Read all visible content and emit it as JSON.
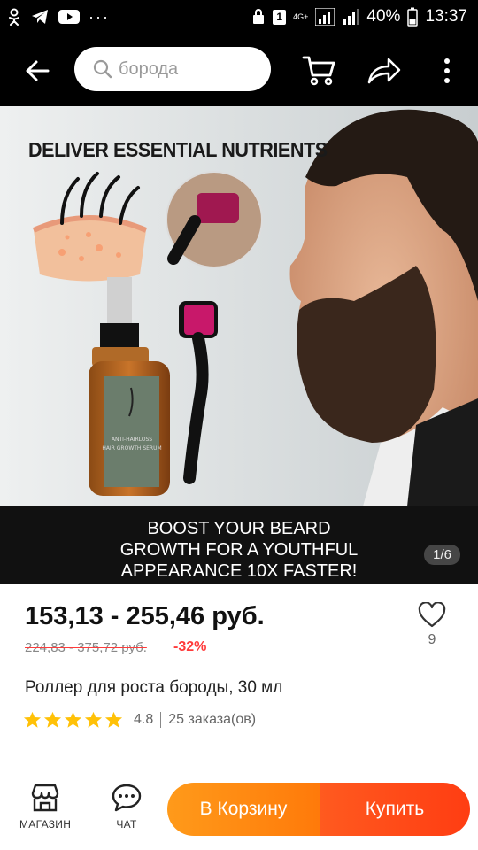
{
  "status_bar": {
    "battery": "40%",
    "time": "13:37",
    "sim_badge": "1",
    "network": "4G+",
    "more": "···"
  },
  "app_bar": {
    "search_placeholder": "борода",
    "icons": [
      "back-arrow-icon",
      "search-icon",
      "cart-icon",
      "share-icon",
      "more-vertical-icon"
    ]
  },
  "product_image": {
    "headline": "DELIVER ESSENTIAL NUTRIENTS",
    "caption_lines": [
      "BOOST YOUR BEARD",
      "GROWTH FOR A YOUTHFUL",
      "APPEARANCE 10X FASTER!"
    ],
    "bottle_label": [
      "ANTI-HAIRLOSS",
      "HAIR GROWTH SERUM"
    ],
    "counter": "1/6"
  },
  "product": {
    "price": "153,13 - 255,46 руб.",
    "old_price": "224,83 - 375,72 руб.",
    "discount": "-32%",
    "favorites_count": "9",
    "title": "Роллер для роста бороды, 30 мл",
    "rating": "4.8",
    "rating_stars": 5,
    "orders": "25 заказа(ов)"
  },
  "bottom_bar": {
    "store_label": "МАГАЗИН",
    "chat_label": "ЧАТ",
    "cart_label": "В Корзину",
    "buy_label": "Купить"
  },
  "colors": {
    "accent_orange": "#ff8a14",
    "accent_red": "#ff4a18",
    "discount_red": "#ff3b3b",
    "star_yellow": "#ffc107"
  }
}
